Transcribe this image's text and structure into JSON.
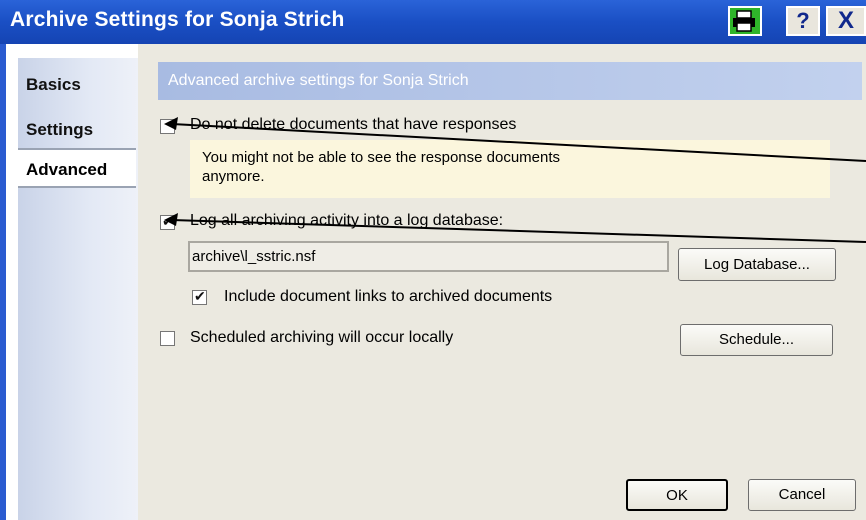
{
  "window": {
    "title": "Archive Settings for Sonja Strich",
    "help_label": "?",
    "close_label": "X"
  },
  "sidebar": {
    "tabs": [
      {
        "label": "Basics"
      },
      {
        "label": "Settings"
      },
      {
        "label": "Advanced",
        "selected": true
      }
    ]
  },
  "main": {
    "header": "Advanced archive settings for Sonja Strich",
    "options": {
      "do_not_delete": {
        "label": "Do not delete documents that have responses",
        "checked": false
      },
      "note": "You might not be able to see the response documents anymore.",
      "log_activity": {
        "label": "Log all archiving activity into a log database:",
        "checked": true
      },
      "log_path": "archive\\l_sstric.nsf",
      "log_db_button": "Log Database...",
      "include_links": {
        "label": "Include document links to archived documents",
        "checked": true
      },
      "scheduled_local": {
        "label": "Scheduled archiving will occur locally",
        "checked": false
      },
      "schedule_button": "Schedule..."
    }
  },
  "footer": {
    "ok_label": "OK",
    "cancel_label": "Cancel"
  },
  "colors": {
    "titlebar": "#1a4fc4",
    "header_band": "#b3c5ea",
    "note_bg": "#fbf6dd",
    "annotation_lines": "#000000"
  },
  "icons": [
    "printer-icon",
    "help-icon",
    "close-icon",
    "checkmark-icon",
    "annotation-arrow"
  ]
}
